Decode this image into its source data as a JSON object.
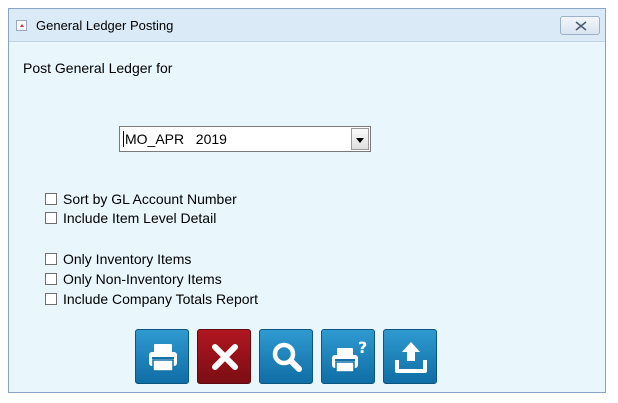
{
  "window": {
    "title": "General Ledger Posting"
  },
  "form": {
    "heading": "Post General Ledger for",
    "period_value": "MO_APR   2019"
  },
  "options": [
    {
      "label": "Sort by GL Account Number",
      "checked": false
    },
    {
      "label": "Include Item Level Detail",
      "checked": false
    },
    {
      "label": "Only Inventory Items",
      "checked": false
    },
    {
      "label": "Only Non-Inventory Items",
      "checked": false
    },
    {
      "label": "Include Company Totals Report",
      "checked": false
    }
  ],
  "toolbar": {
    "buttons": [
      {
        "icon": "printer-icon",
        "color": "#1a7fb8"
      },
      {
        "icon": "close-x-icon",
        "color": "#9a111a"
      },
      {
        "icon": "magnifier-icon",
        "color": "#1a7fb8"
      },
      {
        "icon": "printer-help-icon",
        "color": "#1a7fb8"
      },
      {
        "icon": "export-upload-icon",
        "color": "#1a7fb8"
      }
    ]
  },
  "colors": {
    "window_bg": "#e9f7fd",
    "titlebar_bg": "#dbeaf7",
    "button_blue": "#1a7fb8",
    "button_red": "#9a111a"
  }
}
